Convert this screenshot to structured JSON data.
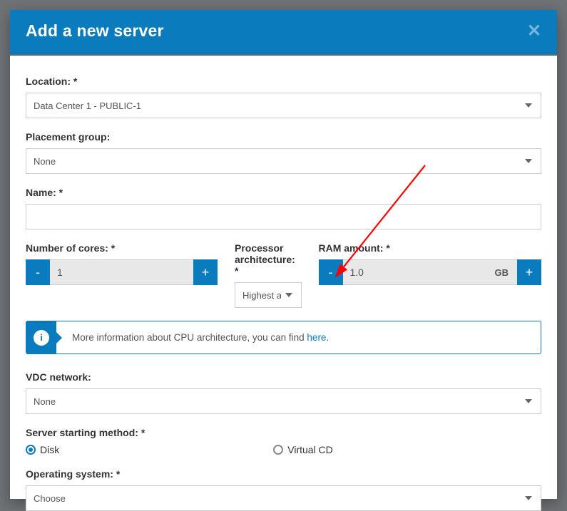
{
  "header": {
    "title": "Add a new server"
  },
  "location": {
    "label": "Location: *",
    "value": "Data Center 1 - PUBLIC-1"
  },
  "placement": {
    "label": "Placement group:",
    "value": "None"
  },
  "name": {
    "label": "Name: *",
    "value": ""
  },
  "cores": {
    "label": "Number of cores: *",
    "value": "1"
  },
  "arch": {
    "label": "Processor architecture: *",
    "value": "Highest available in location"
  },
  "ram": {
    "label": "RAM amount: *",
    "value": "1.0",
    "unit": "GB"
  },
  "info": {
    "text": "More information about CPU architecture, you can find ",
    "link": "here",
    "suffix": "."
  },
  "vdc": {
    "label": "VDC network:",
    "value": "None"
  },
  "start": {
    "label": "Server starting method: *",
    "opt1": "Disk",
    "opt2": "Virtual CD"
  },
  "os": {
    "label": "Operating system: *",
    "value": "Choose"
  },
  "stepper": {
    "minus": "-",
    "plus": "+"
  }
}
